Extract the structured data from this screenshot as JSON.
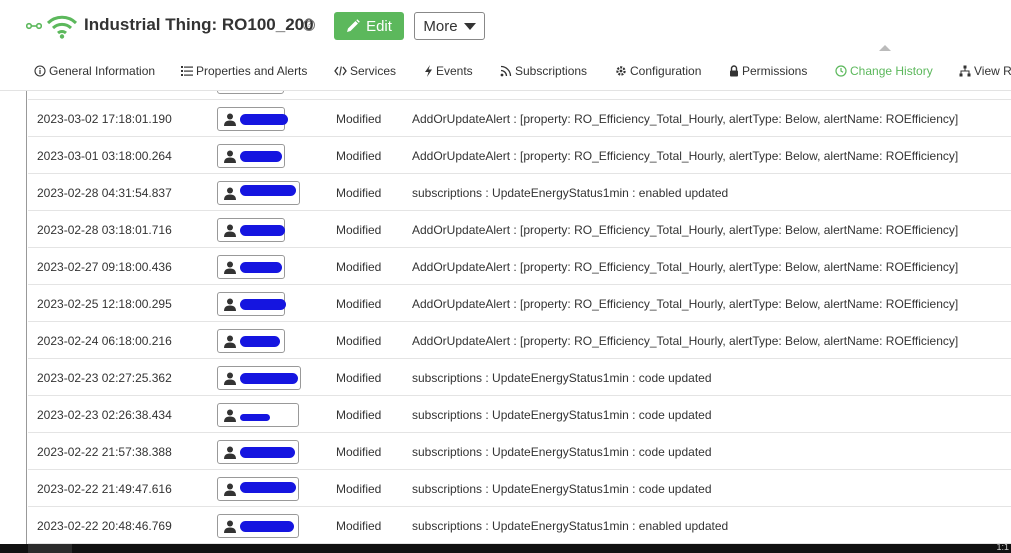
{
  "header": {
    "title": "Industrial Thing: RO100_200",
    "edit_label": "Edit",
    "more_label": "More",
    "help_glyph": "?",
    "accent_color": "#5cb85c"
  },
  "tabs": [
    {
      "label": "General Information",
      "icon": "info-icon"
    },
    {
      "label": "Properties and Alerts",
      "icon": "list-icon"
    },
    {
      "label": "Services",
      "icon": "code-icon"
    },
    {
      "label": "Events",
      "icon": "bolt-icon"
    },
    {
      "label": "Subscriptions",
      "icon": "rss-icon"
    },
    {
      "label": "Configuration",
      "icon": "gear-icon"
    },
    {
      "label": "Permissions",
      "icon": "lock-icon"
    },
    {
      "label": "Change History",
      "icon": "clock-icon",
      "active": true
    },
    {
      "label": "View R",
      "icon": "sitemap-icon"
    }
  ],
  "history": {
    "rows": [
      {
        "timestamp": "2023-03-02 17:18:01.190",
        "type": "Modified",
        "description": "AddOrUpdateAlert : [property: RO_Efficiency_Total_Hourly, alertType: Below, alertName: ROEfficiency]"
      },
      {
        "timestamp": "2023-03-01 03:18:00.264",
        "type": "Modified",
        "description": "AddOrUpdateAlert : [property: RO_Efficiency_Total_Hourly, alertType: Below, alertName: ROEfficiency]"
      },
      {
        "timestamp": "2023-02-28 04:31:54.837",
        "type": "Modified",
        "description": "subscriptions : UpdateEnergyStatus1min : enabled updated"
      },
      {
        "timestamp": "2023-02-28 03:18:01.716",
        "type": "Modified",
        "description": "AddOrUpdateAlert : [property: RO_Efficiency_Total_Hourly, alertType: Below, alertName: ROEfficiency]"
      },
      {
        "timestamp": "2023-02-27 09:18:00.436",
        "type": "Modified",
        "description": "AddOrUpdateAlert : [property: RO_Efficiency_Total_Hourly, alertType: Below, alertName: ROEfficiency]"
      },
      {
        "timestamp": "2023-02-25 12:18:00.295",
        "type": "Modified",
        "description": "AddOrUpdateAlert : [property: RO_Efficiency_Total_Hourly, alertType: Below, alertName: ROEfficiency]"
      },
      {
        "timestamp": "2023-02-24 06:18:00.216",
        "type": "Modified",
        "description": "AddOrUpdateAlert : [property: RO_Efficiency_Total_Hourly, alertType: Below, alertName: ROEfficiency]"
      },
      {
        "timestamp": "2023-02-23 02:27:25.362",
        "type": "Modified",
        "description": "subscriptions : UpdateEnergyStatus1min : code updated"
      },
      {
        "timestamp": "2023-02-23 02:26:38.434",
        "type": "Modified",
        "description": "subscriptions : UpdateEnergyStatus1min : code updated"
      },
      {
        "timestamp": "2023-02-22 21:57:38.388",
        "type": "Modified",
        "description": "subscriptions : UpdateEnergyStatus1min : code updated"
      },
      {
        "timestamp": "2023-02-22 21:49:47.616",
        "type": "Modified",
        "description": "subscriptions : UpdateEnergyStatus1min : code updated"
      },
      {
        "timestamp": "2023-02-22 20:48:46.769",
        "type": "Modified",
        "description": "subscriptions : UpdateEnergyStatus1min : enabled updated"
      }
    ]
  },
  "taskbar": {
    "clock_fragment": "1:1"
  }
}
